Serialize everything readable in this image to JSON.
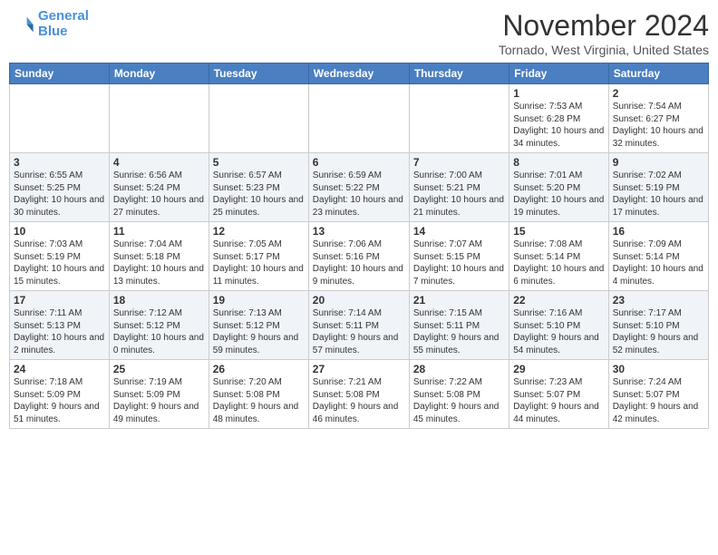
{
  "logo": {
    "line1": "General",
    "line2": "Blue"
  },
  "title": "November 2024",
  "subtitle": "Tornado, West Virginia, United States",
  "headers": [
    "Sunday",
    "Monday",
    "Tuesday",
    "Wednesday",
    "Thursday",
    "Friday",
    "Saturday"
  ],
  "weeks": [
    [
      {
        "day": "",
        "info": ""
      },
      {
        "day": "",
        "info": ""
      },
      {
        "day": "",
        "info": ""
      },
      {
        "day": "",
        "info": ""
      },
      {
        "day": "",
        "info": ""
      },
      {
        "day": "1",
        "info": "Sunrise: 7:53 AM\nSunset: 6:28 PM\nDaylight: 10 hours and 34 minutes."
      },
      {
        "day": "2",
        "info": "Sunrise: 7:54 AM\nSunset: 6:27 PM\nDaylight: 10 hours and 32 minutes."
      }
    ],
    [
      {
        "day": "3",
        "info": "Sunrise: 6:55 AM\nSunset: 5:25 PM\nDaylight: 10 hours and 30 minutes."
      },
      {
        "day": "4",
        "info": "Sunrise: 6:56 AM\nSunset: 5:24 PM\nDaylight: 10 hours and 27 minutes."
      },
      {
        "day": "5",
        "info": "Sunrise: 6:57 AM\nSunset: 5:23 PM\nDaylight: 10 hours and 25 minutes."
      },
      {
        "day": "6",
        "info": "Sunrise: 6:59 AM\nSunset: 5:22 PM\nDaylight: 10 hours and 23 minutes."
      },
      {
        "day": "7",
        "info": "Sunrise: 7:00 AM\nSunset: 5:21 PM\nDaylight: 10 hours and 21 minutes."
      },
      {
        "day": "8",
        "info": "Sunrise: 7:01 AM\nSunset: 5:20 PM\nDaylight: 10 hours and 19 minutes."
      },
      {
        "day": "9",
        "info": "Sunrise: 7:02 AM\nSunset: 5:19 PM\nDaylight: 10 hours and 17 minutes."
      }
    ],
    [
      {
        "day": "10",
        "info": "Sunrise: 7:03 AM\nSunset: 5:19 PM\nDaylight: 10 hours and 15 minutes."
      },
      {
        "day": "11",
        "info": "Sunrise: 7:04 AM\nSunset: 5:18 PM\nDaylight: 10 hours and 13 minutes."
      },
      {
        "day": "12",
        "info": "Sunrise: 7:05 AM\nSunset: 5:17 PM\nDaylight: 10 hours and 11 minutes."
      },
      {
        "day": "13",
        "info": "Sunrise: 7:06 AM\nSunset: 5:16 PM\nDaylight: 10 hours and 9 minutes."
      },
      {
        "day": "14",
        "info": "Sunrise: 7:07 AM\nSunset: 5:15 PM\nDaylight: 10 hours and 7 minutes."
      },
      {
        "day": "15",
        "info": "Sunrise: 7:08 AM\nSunset: 5:14 PM\nDaylight: 10 hours and 6 minutes."
      },
      {
        "day": "16",
        "info": "Sunrise: 7:09 AM\nSunset: 5:14 PM\nDaylight: 10 hours and 4 minutes."
      }
    ],
    [
      {
        "day": "17",
        "info": "Sunrise: 7:11 AM\nSunset: 5:13 PM\nDaylight: 10 hours and 2 minutes."
      },
      {
        "day": "18",
        "info": "Sunrise: 7:12 AM\nSunset: 5:12 PM\nDaylight: 10 hours and 0 minutes."
      },
      {
        "day": "19",
        "info": "Sunrise: 7:13 AM\nSunset: 5:12 PM\nDaylight: 9 hours and 59 minutes."
      },
      {
        "day": "20",
        "info": "Sunrise: 7:14 AM\nSunset: 5:11 PM\nDaylight: 9 hours and 57 minutes."
      },
      {
        "day": "21",
        "info": "Sunrise: 7:15 AM\nSunset: 5:11 PM\nDaylight: 9 hours and 55 minutes."
      },
      {
        "day": "22",
        "info": "Sunrise: 7:16 AM\nSunset: 5:10 PM\nDaylight: 9 hours and 54 minutes."
      },
      {
        "day": "23",
        "info": "Sunrise: 7:17 AM\nSunset: 5:10 PM\nDaylight: 9 hours and 52 minutes."
      }
    ],
    [
      {
        "day": "24",
        "info": "Sunrise: 7:18 AM\nSunset: 5:09 PM\nDaylight: 9 hours and 51 minutes."
      },
      {
        "day": "25",
        "info": "Sunrise: 7:19 AM\nSunset: 5:09 PM\nDaylight: 9 hours and 49 minutes."
      },
      {
        "day": "26",
        "info": "Sunrise: 7:20 AM\nSunset: 5:08 PM\nDaylight: 9 hours and 48 minutes."
      },
      {
        "day": "27",
        "info": "Sunrise: 7:21 AM\nSunset: 5:08 PM\nDaylight: 9 hours and 46 minutes."
      },
      {
        "day": "28",
        "info": "Sunrise: 7:22 AM\nSunset: 5:08 PM\nDaylight: 9 hours and 45 minutes."
      },
      {
        "day": "29",
        "info": "Sunrise: 7:23 AM\nSunset: 5:07 PM\nDaylight: 9 hours and 44 minutes."
      },
      {
        "day": "30",
        "info": "Sunrise: 7:24 AM\nSunset: 5:07 PM\nDaylight: 9 hours and 42 minutes."
      }
    ]
  ]
}
